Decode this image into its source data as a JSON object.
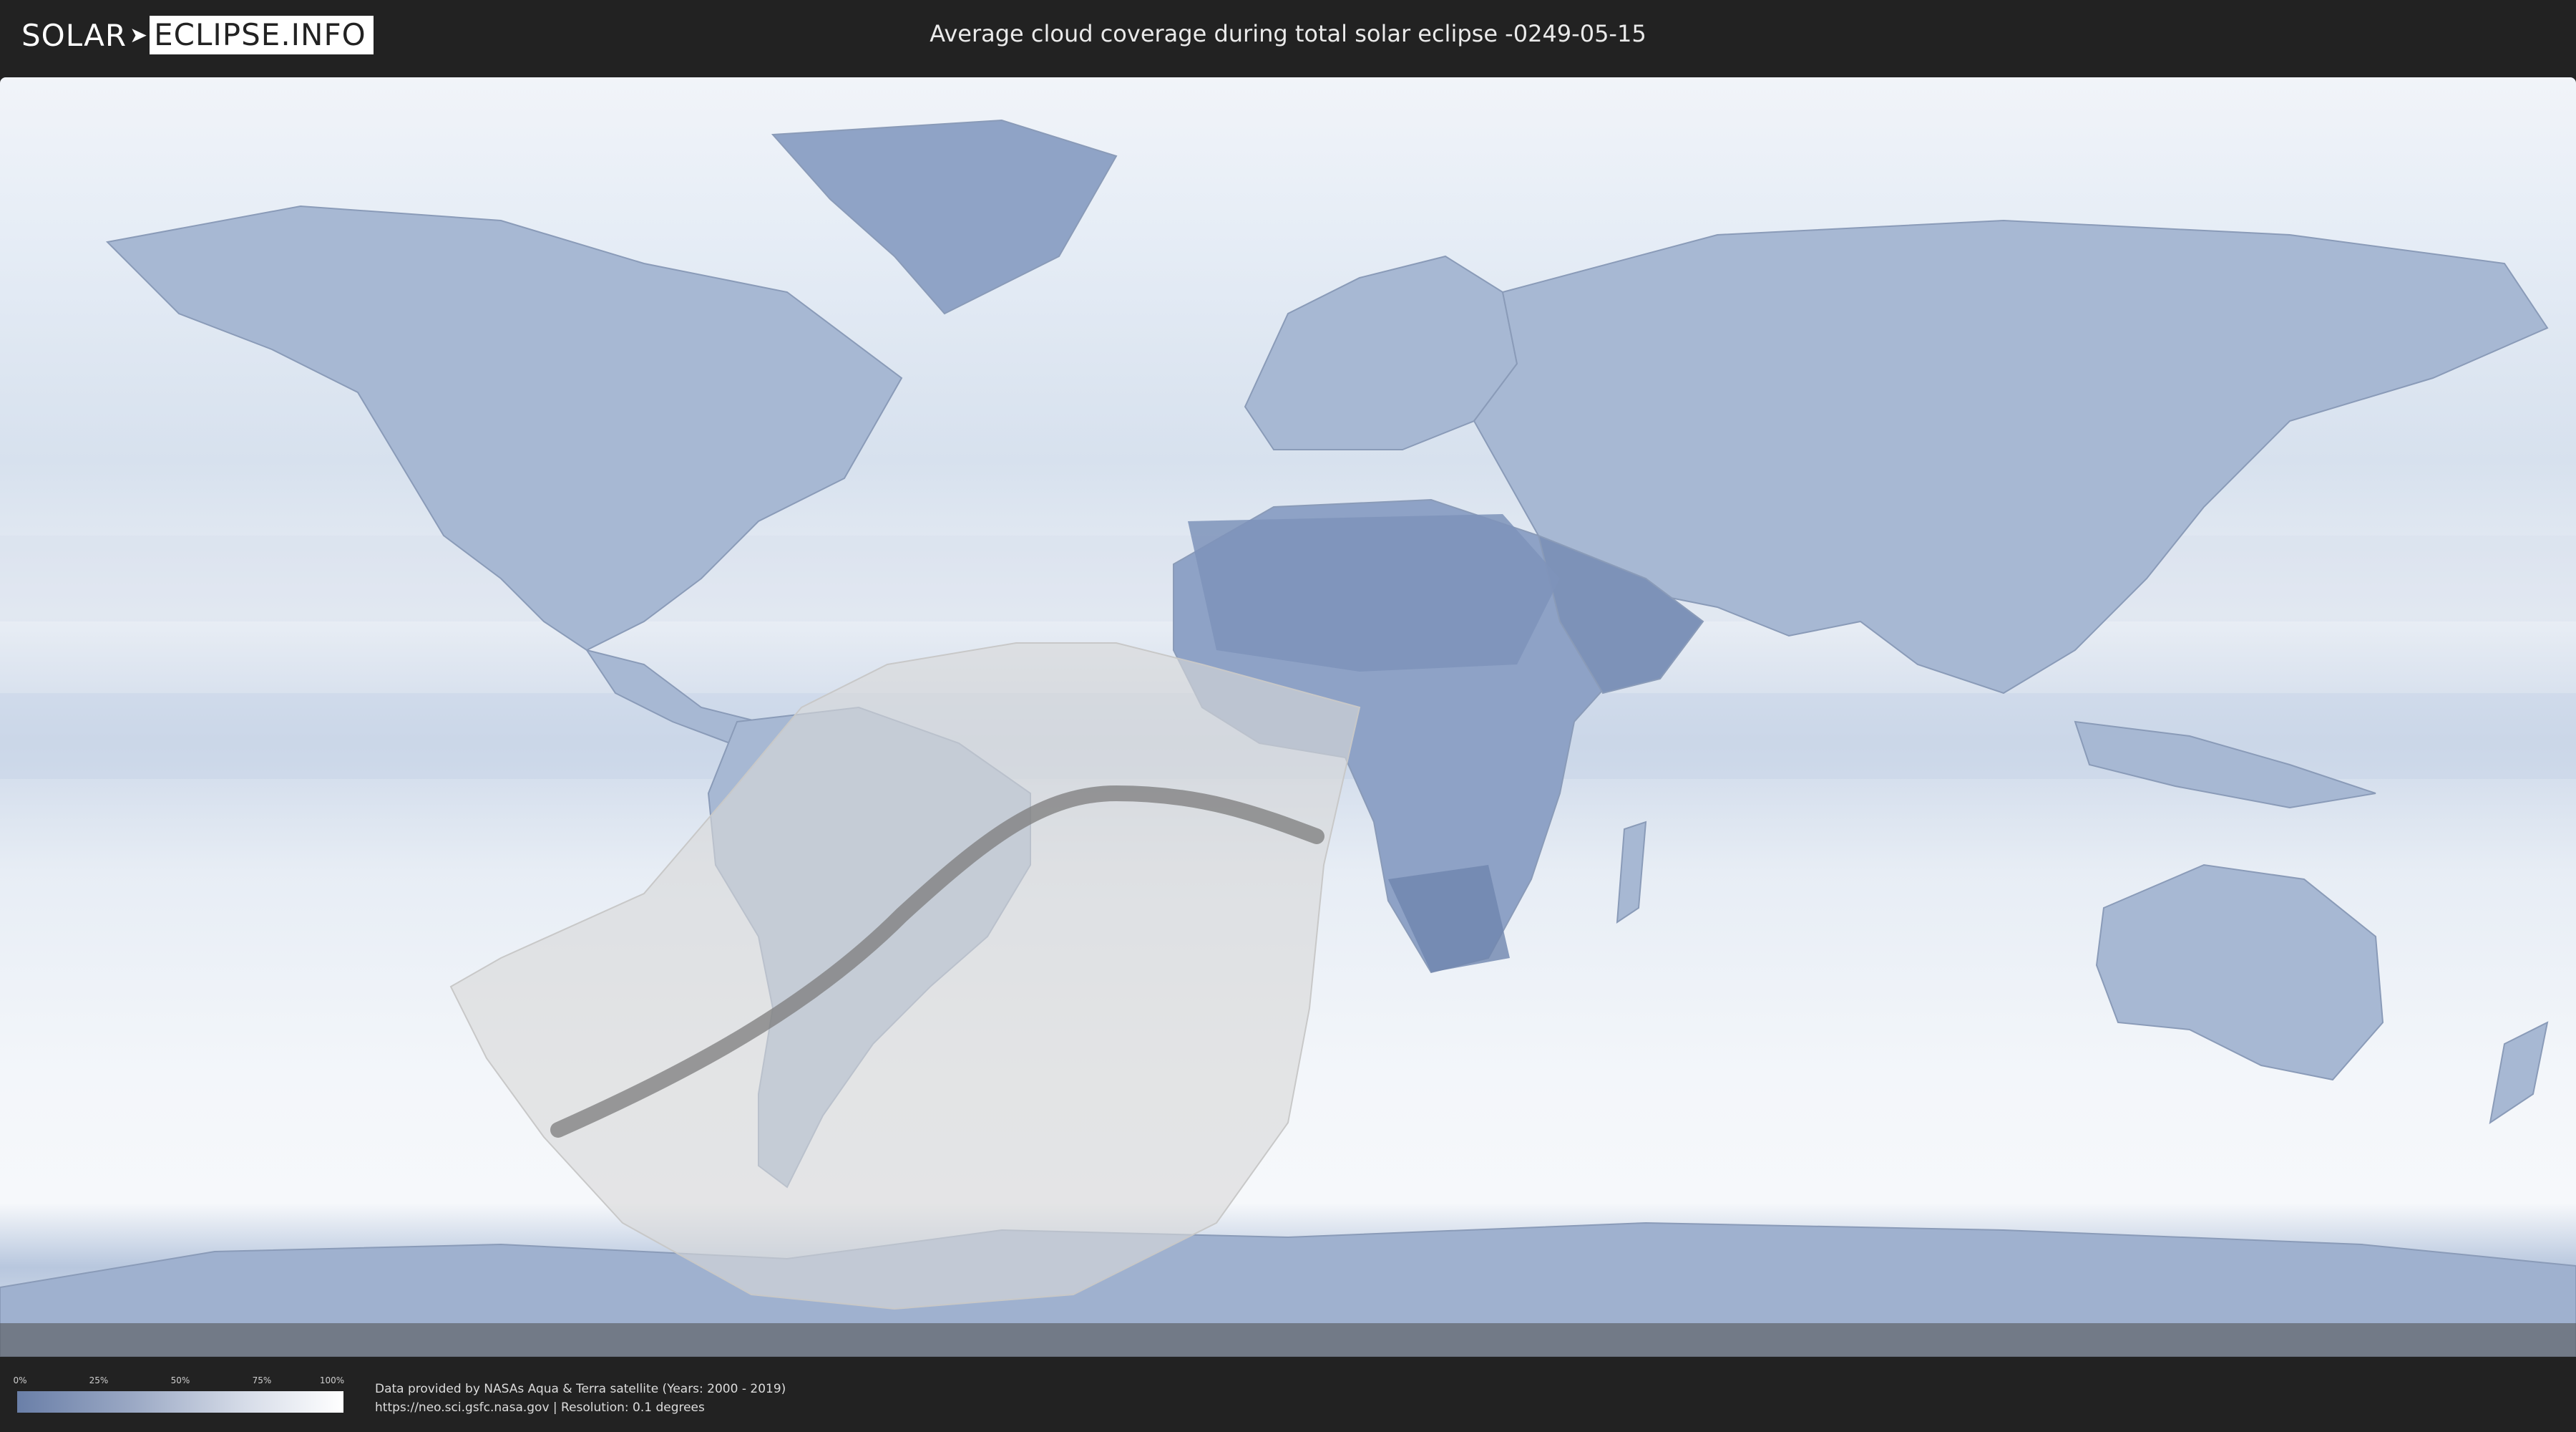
{
  "header": {
    "logo_left": "SOLAR",
    "logo_right": "ECLIPSE.INFO",
    "title": "Average cloud coverage during total solar eclipse -0249-05-15"
  },
  "map": {
    "ocean_color": "#e9eef6",
    "land_cloud_color": "#9fb2d0",
    "dark_cloud_color": "#6f86ae",
    "visibility_zone_color": "#d9d9d9",
    "path_color": "#7c7c7c"
  },
  "legend": {
    "ticks": [
      "0%",
      "25%",
      "50%",
      "75%",
      "100%"
    ]
  },
  "credits": {
    "line1": "Data provided by NASAs Aqua & Terra satellite (Years: 2000 - 2019)",
    "line2": "https://neo.sci.gsfc.nasa.gov | Resolution: 0.1 degrees"
  }
}
